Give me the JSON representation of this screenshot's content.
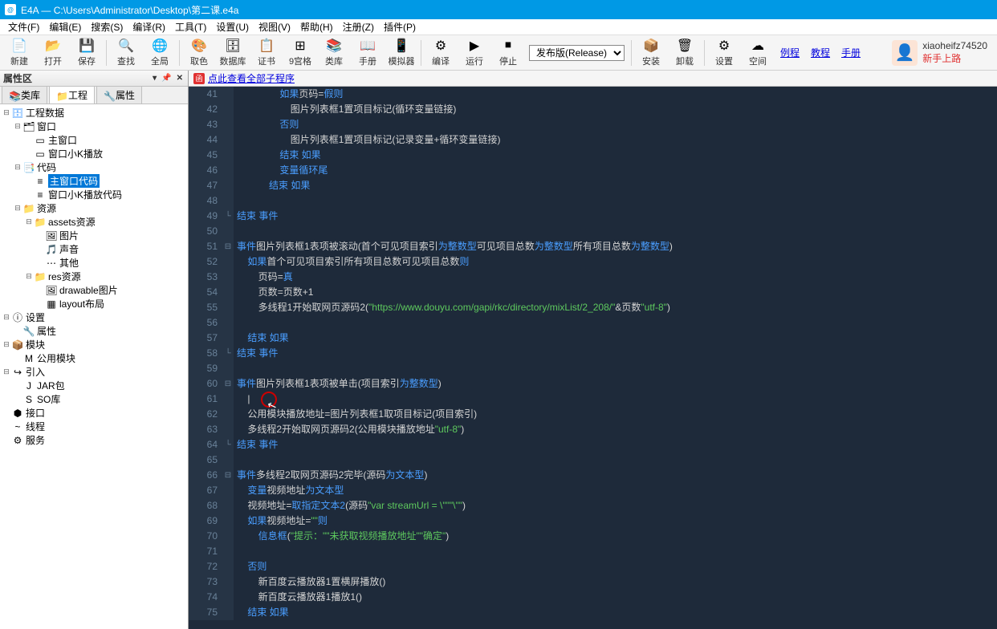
{
  "title": "E4A — C:\\Users\\Administrator\\Desktop\\第二课.e4a",
  "menubar": [
    "文件(F)",
    "编辑(E)",
    "搜索(S)",
    "编译(R)",
    "工具(T)",
    "设置(U)",
    "视图(V)",
    "帮助(H)",
    "注册(Z)",
    "插件(P)"
  ],
  "toolbar": [
    {
      "icon": "📄",
      "label": "新建"
    },
    {
      "icon": "📂",
      "label": "打开"
    },
    {
      "icon": "💾",
      "label": "保存"
    },
    {
      "sep": true
    },
    {
      "icon": "🔍",
      "label": "查找"
    },
    {
      "icon": "🌐",
      "label": "全局"
    },
    {
      "sep": true
    },
    {
      "icon": "🎨",
      "label": "取色"
    },
    {
      "icon": "🗄",
      "label": "数据库"
    },
    {
      "icon": "📋",
      "label": "证书"
    },
    {
      "icon": "⊞",
      "label": "9宫格"
    },
    {
      "icon": "📚",
      "label": "类库"
    },
    {
      "icon": "📖",
      "label": "手册"
    },
    {
      "icon": "📱",
      "label": "模拟器"
    },
    {
      "sep": true
    },
    {
      "icon": "⚙",
      "label": "编译"
    },
    {
      "icon": "▶",
      "label": "运行"
    },
    {
      "icon": "⏹",
      "label": "停止"
    },
    {
      "combo": "发布版(Release)"
    },
    {
      "sep": true
    },
    {
      "icon": "📦",
      "label": "安装"
    },
    {
      "icon": "🗑",
      "label": "卸载"
    },
    {
      "sep": true
    },
    {
      "icon": "⚙",
      "label": "设置"
    },
    {
      "icon": "☁",
      "label": "空间"
    }
  ],
  "toolbar_links": [
    "例程",
    "教程",
    "手册"
  ],
  "user": {
    "name": "xiaoheifz74520",
    "rank": "新手上路"
  },
  "panel": {
    "title": "属性区",
    "tabs": [
      "类库",
      "工程",
      "属性"
    ],
    "active": 1
  },
  "tree": [
    {
      "l": 0,
      "t": "⊟",
      "i": "🗄",
      "txt": "工程数据",
      "cls": "db-ico"
    },
    {
      "l": 1,
      "t": "⊟",
      "i": "🗂",
      "txt": "窗口"
    },
    {
      "l": 2,
      "t": "",
      "i": "▭",
      "txt": "主窗口"
    },
    {
      "l": 2,
      "t": "",
      "i": "▭",
      "txt": "窗口小K播放"
    },
    {
      "l": 1,
      "t": "⊟",
      "i": "📑",
      "txt": "代码"
    },
    {
      "l": 2,
      "t": "",
      "i": "≡",
      "txt": "主窗口代码",
      "sel": true
    },
    {
      "l": 2,
      "t": "",
      "i": "≡",
      "txt": "窗口小K播放代码"
    },
    {
      "l": 1,
      "t": "⊟",
      "i": "📁",
      "txt": "资源",
      "cls": "folder-ico"
    },
    {
      "l": 2,
      "t": "⊟",
      "i": "📁",
      "txt": "assets资源",
      "cls": "folder-ico"
    },
    {
      "l": 3,
      "t": "",
      "i": "🖼",
      "txt": "图片"
    },
    {
      "l": 3,
      "t": "",
      "i": "🎵",
      "txt": "声音"
    },
    {
      "l": 3,
      "t": "",
      "i": "⋯",
      "txt": "其他"
    },
    {
      "l": 2,
      "t": "⊟",
      "i": "📁",
      "txt": "res资源",
      "cls": "folder-ico"
    },
    {
      "l": 3,
      "t": "",
      "i": "🖼",
      "txt": "drawable图片"
    },
    {
      "l": 3,
      "t": "",
      "i": "▦",
      "txt": "layout布局"
    },
    {
      "l": 0,
      "t": "⊟",
      "i": "ⓘ",
      "txt": "设置"
    },
    {
      "l": 1,
      "t": "",
      "i": "🔧",
      "txt": "属性"
    },
    {
      "l": 0,
      "t": "⊟",
      "i": "📦",
      "txt": "模块"
    },
    {
      "l": 1,
      "t": "",
      "i": "M",
      "txt": "公用模块"
    },
    {
      "l": 0,
      "t": "⊟",
      "i": "↪",
      "txt": "引入"
    },
    {
      "l": 1,
      "t": "",
      "i": "J",
      "txt": "JAR包"
    },
    {
      "l": 1,
      "t": "",
      "i": "S",
      "txt": "SO库"
    },
    {
      "l": 0,
      "t": "",
      "i": "⬢",
      "txt": "接口"
    },
    {
      "l": 0,
      "t": "",
      "i": "~",
      "txt": "线程"
    },
    {
      "l": 0,
      "t": "",
      "i": "⚙",
      "txt": "服务"
    }
  ],
  "editor_tab": "点此查看全部子程序",
  "code": [
    {
      "n": 41,
      "f": "",
      "t": [
        "                ",
        [
          "kw",
          "如果"
        ],
        [
          " ",
          ""
        ],
        [
          "fn",
          "页码"
        ],
        [
          "assign",
          "="
        ],
        [
          "kw",
          "假"
        ],
        [
          " ",
          ""
        ],
        [
          "kw",
          "则"
        ]
      ]
    },
    {
      "n": 42,
      "f": "",
      "t": [
        "                    ",
        [
          "fn",
          "图片列表框1"
        ],
        [
          ".",
          ""
        ],
        [
          "fn",
          "置项目标记"
        ],
        [
          "op",
          "("
        ],
        [
          "fn",
          "循环变量"
        ],
        [
          ".",
          ""
        ],
        [
          "fn",
          "链接"
        ],
        [
          "op",
          ")"
        ]
      ]
    },
    {
      "n": 43,
      "f": "",
      "t": [
        "                ",
        [
          "kw",
          "否则"
        ]
      ]
    },
    {
      "n": 44,
      "f": "",
      "t": [
        "                    ",
        [
          "fn",
          "图片列表框1"
        ],
        [
          ".",
          ""
        ],
        [
          "fn",
          "置项目标记"
        ],
        [
          "op",
          "("
        ],
        [
          "fn",
          "记录变量"
        ],
        [
          "op",
          "+"
        ],
        [
          "fn",
          "循环变量"
        ],
        [
          ".",
          ""
        ],
        [
          "fn",
          "链接"
        ],
        [
          "op",
          ")"
        ]
      ]
    },
    {
      "n": 45,
      "f": "",
      "t": [
        "                ",
        [
          "kw",
          "结束 如果"
        ]
      ]
    },
    {
      "n": 46,
      "f": "",
      "t": [
        "                ",
        [
          "kw",
          "变量循环尾"
        ]
      ]
    },
    {
      "n": 47,
      "f": "",
      "t": [
        "            ",
        [
          "kw",
          "结束 如果"
        ]
      ]
    },
    {
      "n": 48,
      "f": "",
      "t": [
        ""
      ]
    },
    {
      "n": 49,
      "f": "└",
      "t": [
        "",
        [
          "kw",
          "结束 事件"
        ]
      ]
    },
    {
      "n": 50,
      "f": "",
      "t": [
        ""
      ]
    },
    {
      "n": 51,
      "f": "⊟",
      "t": [
        "",
        [
          "kw",
          "事件"
        ],
        [
          " ",
          ""
        ],
        [
          "fn",
          "图片列表框1"
        ],
        [
          ".",
          ""
        ],
        [
          "fn",
          "表项被滚动"
        ],
        [
          "op",
          "("
        ],
        [
          "fn",
          "首个可见项目索引"
        ],
        [
          " ",
          ""
        ],
        [
          "kw",
          "为"
        ],
        [
          " ",
          ""
        ],
        [
          "type",
          "整数型"
        ],
        [
          ".",
          ""
        ],
        [
          "fn",
          "可见项目总数"
        ],
        [
          " ",
          ""
        ],
        [
          "kw",
          "为"
        ],
        [
          " ",
          ""
        ],
        [
          "type",
          "整数型"
        ],
        [
          ".",
          ""
        ],
        [
          "fn",
          "所有项目总数"
        ],
        [
          " ",
          ""
        ],
        [
          "kw",
          "为"
        ],
        [
          " ",
          ""
        ],
        [
          "type",
          "整数型"
        ],
        [
          "op",
          ")"
        ]
      ]
    },
    {
      "n": 52,
      "f": "",
      "t": [
        "    ",
        [
          "kw",
          "如果"
        ],
        [
          " ",
          ""
        ],
        [
          "fn",
          "首个可见项目索引"
        ],
        [
          " = ",
          ""
        ],
        [
          "fn",
          "所有项目总数"
        ],
        [
          " - ",
          ""
        ],
        [
          "fn",
          "可见项目总数"
        ],
        [
          " ",
          ""
        ],
        [
          "kw",
          "则"
        ]
      ]
    },
    {
      "n": 53,
      "f": "",
      "t": [
        "        ",
        [
          "fn",
          "页码"
        ],
        [
          "assign",
          "="
        ],
        [
          "kw",
          "真"
        ]
      ]
    },
    {
      "n": 54,
      "f": "",
      "t": [
        "        ",
        [
          "fn",
          "页数"
        ],
        [
          "assign",
          "="
        ],
        [
          "fn",
          "页数"
        ],
        [
          "num",
          "+1"
        ]
      ]
    },
    {
      "n": 55,
      "f": "",
      "t": [
        "        ",
        [
          "fn",
          "多线程1"
        ],
        [
          ".",
          ""
        ],
        [
          "fn",
          "开始取网页源码2"
        ],
        [
          "op",
          "("
        ],
        [
          "str",
          "\"https://www.douyu.com/gapi/rkc/directory/mixList/2_208/\""
        ],
        [
          "op",
          "&"
        ],
        [
          "fn",
          "页数"
        ],
        [
          ".",
          ""
        ],
        [
          "str",
          "\"utf-8\""
        ],
        [
          "op",
          ")"
        ]
      ]
    },
    {
      "n": 56,
      "f": "",
      "t": [
        ""
      ]
    },
    {
      "n": 57,
      "f": "",
      "t": [
        "    ",
        [
          "kw",
          "结束 如果"
        ]
      ]
    },
    {
      "n": 58,
      "f": "└",
      "t": [
        "",
        [
          "kw",
          "结束 事件"
        ]
      ]
    },
    {
      "n": 59,
      "f": "",
      "t": [
        ""
      ]
    },
    {
      "n": 60,
      "f": "⊟",
      "t": [
        "",
        [
          "kw",
          "事件"
        ],
        [
          " ",
          ""
        ],
        [
          "fn",
          "图片列表框1"
        ],
        [
          ".",
          ""
        ],
        [
          "fn",
          "表项被单击"
        ],
        [
          "op",
          "("
        ],
        [
          "fn",
          "项目索引"
        ],
        [
          " ",
          ""
        ],
        [
          "kw",
          "为"
        ],
        [
          " ",
          ""
        ],
        [
          "type",
          "整数型"
        ],
        [
          "op",
          ")"
        ]
      ]
    },
    {
      "n": 61,
      "f": "",
      "t": [
        "    |"
      ]
    },
    {
      "n": 62,
      "f": "",
      "t": [
        "    ",
        [
          "fn",
          "公用模块"
        ],
        [
          ".",
          ""
        ],
        [
          "fn",
          "播放地址"
        ],
        [
          "assign",
          "="
        ],
        [
          "fn",
          "图片列表框1"
        ],
        [
          ".",
          ""
        ],
        [
          "fn",
          "取项目标记"
        ],
        [
          "op",
          "("
        ],
        [
          "fn",
          "项目索引"
        ],
        [
          "op",
          ")"
        ]
      ]
    },
    {
      "n": 63,
      "f": "",
      "t": [
        "    ",
        [
          "fn",
          "多线程2"
        ],
        [
          ".",
          ""
        ],
        [
          "fn",
          "开始取网页源码2"
        ],
        [
          "op",
          "("
        ],
        [
          "fn",
          "公用模块"
        ],
        [
          ".",
          ""
        ],
        [
          "fn",
          "播放地址"
        ],
        [
          ".",
          ""
        ],
        [
          "str",
          "\"utf-8\""
        ],
        [
          "op",
          ")"
        ]
      ]
    },
    {
      "n": 64,
      "f": "└",
      "t": [
        "",
        [
          "kw",
          "结束 事件"
        ]
      ]
    },
    {
      "n": 65,
      "f": "",
      "t": [
        ""
      ]
    },
    {
      "n": 66,
      "f": "⊟",
      "t": [
        "",
        [
          "kw",
          "事件"
        ],
        [
          " ",
          ""
        ],
        [
          "fn",
          "多线程2"
        ],
        [
          ".",
          ""
        ],
        [
          "fn",
          "取网页源码2完毕"
        ],
        [
          "op",
          "("
        ],
        [
          "fn",
          "源码"
        ],
        [
          " ",
          ""
        ],
        [
          "kw",
          "为"
        ],
        [
          " ",
          ""
        ],
        [
          "type",
          "文本型"
        ],
        [
          "op",
          ")"
        ]
      ]
    },
    {
      "n": 67,
      "f": "",
      "t": [
        "    ",
        [
          "kw",
          "变量"
        ],
        [
          " ",
          ""
        ],
        [
          "fn",
          "视频地址"
        ],
        [
          " ",
          ""
        ],
        [
          "kw",
          "为"
        ],
        [
          " ",
          ""
        ],
        [
          "type",
          "文本型"
        ]
      ]
    },
    {
      "n": 68,
      "f": "",
      "t": [
        "    ",
        [
          "fn",
          "视频地址"
        ],
        [
          "assign",
          "="
        ],
        [
          "kw",
          "取指定文本2"
        ],
        [
          "op",
          "("
        ],
        [
          "fn",
          "源码"
        ],
        [
          ".",
          ""
        ],
        [
          "str",
          "\"var streamUrl = \\\"\""
        ],
        [
          ".",
          ""
        ],
        [
          "str",
          "\"\\\"\""
        ],
        [
          "op",
          ")"
        ]
      ]
    },
    {
      "n": 69,
      "f": "",
      "t": [
        "    ",
        [
          "kw",
          "如果"
        ],
        [
          " ",
          ""
        ],
        [
          "fn",
          "视频地址"
        ],
        [
          "assign",
          "="
        ],
        [
          "str",
          "\"\""
        ],
        [
          " ",
          ""
        ],
        [
          "kw",
          "则"
        ]
      ]
    },
    {
      "n": 70,
      "f": "",
      "t": [
        "        ",
        [
          "kw",
          "信息框"
        ],
        [
          "op",
          "("
        ],
        [
          "str",
          "\"提示：\""
        ],
        [
          ".",
          ""
        ],
        [
          "str",
          "\"未获取视频播放地址\""
        ],
        [
          ".",
          ""
        ],
        [
          "str",
          "\"确定\""
        ],
        [
          "op",
          ")"
        ]
      ]
    },
    {
      "n": 71,
      "f": "",
      "t": [
        ""
      ]
    },
    {
      "n": 72,
      "f": "",
      "t": [
        "    ",
        [
          "kw",
          "否则"
        ]
      ]
    },
    {
      "n": 73,
      "f": "",
      "t": [
        "        ",
        [
          "fn",
          "新百度云播放器1"
        ],
        [
          ".",
          ""
        ],
        [
          "fn",
          "置横屏播放"
        ],
        [
          "op",
          "()"
        ]
      ]
    },
    {
      "n": 74,
      "f": "",
      "t": [
        "        ",
        [
          "fn",
          "新百度云播放器1"
        ],
        [
          ".",
          ""
        ],
        [
          "fn",
          "播放1"
        ],
        [
          "op",
          "()"
        ]
      ]
    },
    {
      "n": 75,
      "f": "",
      "t": [
        "    ",
        [
          "kw",
          "结束 如果"
        ]
      ]
    }
  ]
}
